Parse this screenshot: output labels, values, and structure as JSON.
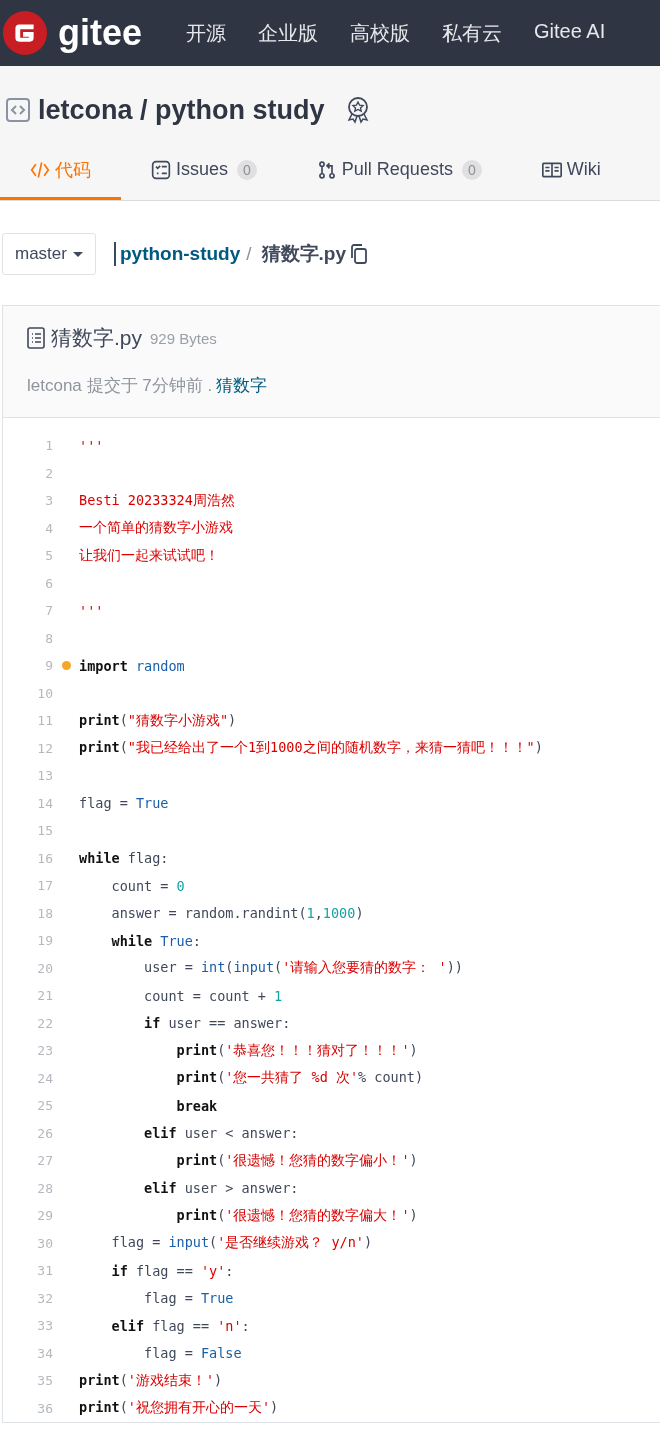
{
  "header": {
    "logo": "gitee",
    "nav": [
      "开源",
      "企业版",
      "高校版",
      "私有云",
      "Gitee AI"
    ]
  },
  "repo": {
    "owner": "letcona",
    "separator": "/",
    "name": "python study"
  },
  "tabs": [
    {
      "label": "代码",
      "selected": true
    },
    {
      "label": "Issues",
      "count": "0",
      "selected": false
    },
    {
      "label": "Pull Requests",
      "count": "0",
      "selected": false
    },
    {
      "label": "Wiki",
      "selected": false
    }
  ],
  "breadcrumb": {
    "branch": "master",
    "repo_link": "python-study",
    "separator": "/",
    "file": "猜数字.py"
  },
  "file": {
    "name": "猜数字.py",
    "size": "929 Bytes",
    "commit_text": "letcona 提交于 7分钟前 .",
    "commit_message": "猜数字"
  },
  "code": [
    {
      "number": "1",
      "marked": false,
      "tokens": [
        {
          "kind": "str",
          "text": "'''"
        }
      ]
    },
    {
      "number": "2",
      "marked": false
    },
    {
      "number": "3",
      "marked": false,
      "tokens": [
        {
          "kind": "str",
          "text": "Besti 20233324周浩然"
        }
      ]
    },
    {
      "number": "4",
      "marked": false,
      "tokens": [
        {
          "kind": "str",
          "text": "一个简单的猜数字小游戏"
        }
      ]
    },
    {
      "number": "5",
      "marked": false,
      "tokens": [
        {
          "kind": "str",
          "text": "让我们一起来试试吧！"
        }
      ]
    },
    {
      "number": "6",
      "marked": false
    },
    {
      "number": "7",
      "marked": false,
      "tokens": [
        {
          "kind": "str",
          "text": "'''"
        }
      ]
    },
    {
      "number": "8",
      "marked": false
    },
    {
      "number": "9",
      "marked": true,
      "tokens": [
        {
          "kind": "kw",
          "text": "import"
        },
        {
          "kind": "name",
          "text": " random"
        }
      ]
    },
    {
      "number": "10",
      "marked": false
    },
    {
      "number": "11",
      "marked": false,
      "tokens": [
        {
          "kind": "kw",
          "text": "print"
        },
        {
          "kind": "plain",
          "text": "("
        },
        {
          "kind": "str",
          "text": "\"猜数字小游戏\""
        },
        {
          "kind": "plain",
          "text": ")"
        }
      ]
    },
    {
      "number": "12",
      "marked": false,
      "tokens": [
        {
          "kind": "kw",
          "text": "print"
        },
        {
          "kind": "plain",
          "text": "("
        },
        {
          "kind": "str",
          "text": "\"我已经给出了一个1到1000之间的随机数字，来猜一猜吧！！！\""
        },
        {
          "kind": "plain",
          "text": ")"
        }
      ]
    },
    {
      "number": "13",
      "marked": false
    },
    {
      "number": "14",
      "marked": false,
      "tokens": [
        {
          "kind": "plain",
          "text": "flag = "
        },
        {
          "kind": "name",
          "text": "True"
        }
      ]
    },
    {
      "number": "15",
      "marked": false
    },
    {
      "number": "16",
      "marked": false,
      "tokens": [
        {
          "kind": "kw",
          "text": "while"
        },
        {
          "kind": "plain",
          "text": " flag:"
        }
      ]
    },
    {
      "number": "17",
      "marked": false,
      "tokens": [
        {
          "kind": "plain",
          "text": "    count = "
        },
        {
          "kind": "num",
          "text": "0"
        }
      ]
    },
    {
      "number": "18",
      "marked": false,
      "tokens": [
        {
          "kind": "plain",
          "text": "    answer = random.randint("
        },
        {
          "kind": "num",
          "text": "1"
        },
        {
          "kind": "plain",
          "text": ","
        },
        {
          "kind": "num",
          "text": "1000"
        },
        {
          "kind": "plain",
          "text": ")"
        }
      ]
    },
    {
      "number": "19",
      "marked": false,
      "tokens": [
        {
          "kind": "kw",
          "text": "    while"
        },
        {
          "kind": "name",
          "text": " True"
        },
        {
          "kind": "plain",
          "text": ":"
        }
      ]
    },
    {
      "number": "20",
      "marked": false,
      "tokens": [
        {
          "kind": "plain",
          "text": "        user = "
        },
        {
          "kind": "name",
          "text": "int"
        },
        {
          "kind": "plain",
          "text": "("
        },
        {
          "kind": "name",
          "text": "input"
        },
        {
          "kind": "plain",
          "text": "("
        },
        {
          "kind": "str",
          "text": "'请输入您要猜的数字： '"
        },
        {
          "kind": "plain",
          "text": "))"
        }
      ]
    },
    {
      "number": "21",
      "marked": false,
      "tokens": [
        {
          "kind": "plain",
          "text": "        count = count + "
        },
        {
          "kind": "num",
          "text": "1"
        }
      ]
    },
    {
      "number": "22",
      "marked": false,
      "tokens": [
        {
          "kind": "kw",
          "text": "        if"
        },
        {
          "kind": "plain",
          "text": " user == answer:"
        }
      ]
    },
    {
      "number": "23",
      "marked": false,
      "tokens": [
        {
          "kind": "kw",
          "text": "            print"
        },
        {
          "kind": "plain",
          "text": "("
        },
        {
          "kind": "str",
          "text": "'恭喜您！！！猜对了！！！'"
        },
        {
          "kind": "plain",
          "text": ")"
        }
      ]
    },
    {
      "number": "24",
      "marked": false,
      "tokens": [
        {
          "kind": "kw",
          "text": "            print"
        },
        {
          "kind": "plain",
          "text": "("
        },
        {
          "kind": "str",
          "text": "'您一共猜了 %d 次'"
        },
        {
          "kind": "plain",
          "text": "% count)"
        }
      ]
    },
    {
      "number": "25",
      "marked": false,
      "tokens": [
        {
          "kind": "kw",
          "text": "            break"
        }
      ]
    },
    {
      "number": "26",
      "marked": false,
      "tokens": [
        {
          "kind": "kw",
          "text": "        elif"
        },
        {
          "kind": "plain",
          "text": " user < answer:"
        }
      ]
    },
    {
      "number": "27",
      "marked": false,
      "tokens": [
        {
          "kind": "kw",
          "text": "            print"
        },
        {
          "kind": "plain",
          "text": "("
        },
        {
          "kind": "str",
          "text": "'很遗憾！您猜的数字偏小！'"
        },
        {
          "kind": "plain",
          "text": ")"
        }
      ]
    },
    {
      "number": "28",
      "marked": false,
      "tokens": [
        {
          "kind": "kw",
          "text": "        elif"
        },
        {
          "kind": "plain",
          "text": " user > answer:"
        }
      ]
    },
    {
      "number": "29",
      "marked": false,
      "tokens": [
        {
          "kind": "kw",
          "text": "            print"
        },
        {
          "kind": "plain",
          "text": "("
        },
        {
          "kind": "str",
          "text": "'很遗憾！您猜的数字偏大！'"
        },
        {
          "kind": "plain",
          "text": ")"
        }
      ]
    },
    {
      "number": "30",
      "marked": false,
      "tokens": [
        {
          "kind": "plain",
          "text": "    flag = "
        },
        {
          "kind": "name",
          "text": "input"
        },
        {
          "kind": "plain",
          "text": "("
        },
        {
          "kind": "str",
          "text": "'是否继续游戏？ y/n'"
        },
        {
          "kind": "plain",
          "text": ")"
        }
      ]
    },
    {
      "number": "31",
      "marked": false,
      "tokens": [
        {
          "kind": "kw",
          "text": "    if"
        },
        {
          "kind": "plain",
          "text": " flag == "
        },
        {
          "kind": "str",
          "text": "'y'"
        },
        {
          "kind": "plain",
          "text": ":"
        }
      ]
    },
    {
      "number": "32",
      "marked": false,
      "tokens": [
        {
          "kind": "plain",
          "text": "        flag = "
        },
        {
          "kind": "name",
          "text": "True"
        }
      ]
    },
    {
      "number": "33",
      "marked": false,
      "tokens": [
        {
          "kind": "kw",
          "text": "    elif"
        },
        {
          "kind": "plain",
          "text": " flag == "
        },
        {
          "kind": "str",
          "text": "'n'"
        },
        {
          "kind": "plain",
          "text": ":"
        }
      ]
    },
    {
      "number": "34",
      "marked": false,
      "tokens": [
        {
          "kind": "plain",
          "text": "        flag = "
        },
        {
          "kind": "name",
          "text": "False"
        }
      ]
    },
    {
      "number": "35",
      "marked": false,
      "tokens": [
        {
          "kind": "kw",
          "text": "print"
        },
        {
          "kind": "plain",
          "text": "("
        },
        {
          "kind": "str",
          "text": "'游戏结束！'"
        },
        {
          "kind": "plain",
          "text": ")"
        }
      ]
    },
    {
      "number": "36",
      "marked": false,
      "tokens": [
        {
          "kind": "kw",
          "text": "print"
        },
        {
          "kind": "plain",
          "text": "("
        },
        {
          "kind": "str",
          "text": "'祝您拥有开心的一天'"
        },
        {
          "kind": "plain",
          "text": ")"
        }
      ]
    }
  ]
}
